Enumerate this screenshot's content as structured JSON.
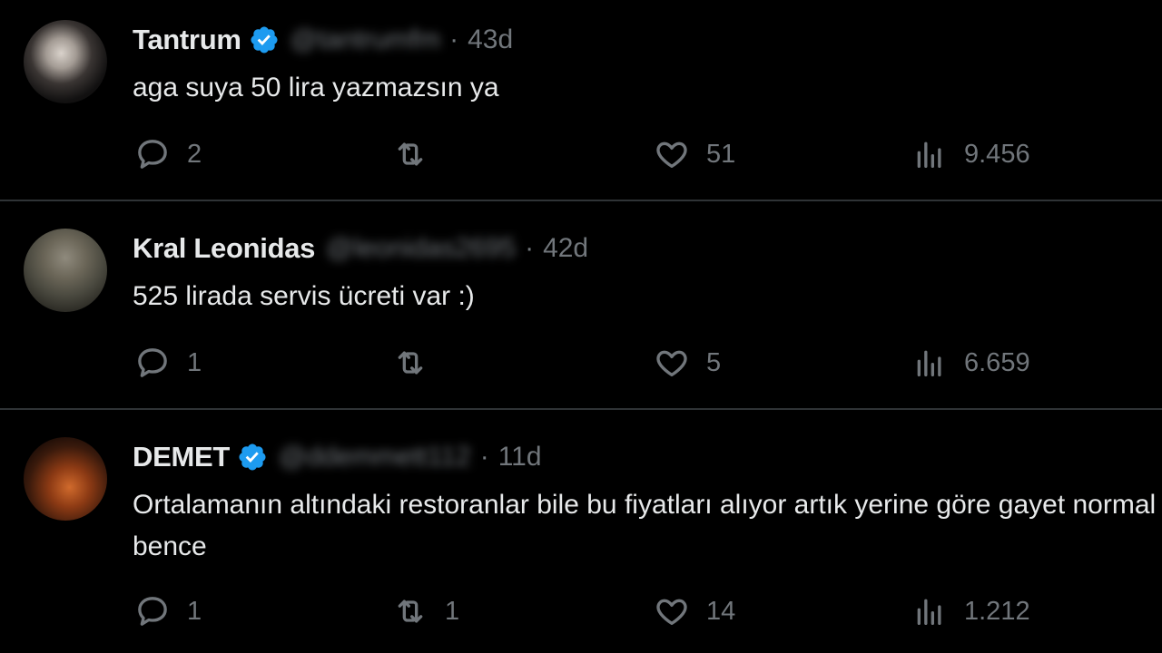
{
  "tweets": [
    {
      "name": "Tantrum",
      "verified": true,
      "handle": "@tantrumfm",
      "separator": "·",
      "time": "43d",
      "text": "aga suya 50 lira yazmazsın ya",
      "replies": "2",
      "retweets": "",
      "likes": "51",
      "views": "9.456"
    },
    {
      "name": "Kral Leonidas",
      "verified": false,
      "handle": "@leonidas2695",
      "separator": "·",
      "time": "42d",
      "text": "525 lirada servis ücreti var :)",
      "replies": "1",
      "retweets": "",
      "likes": "5",
      "views": "6.659"
    },
    {
      "name": "DEMET",
      "verified": true,
      "handle": "@ddemmett112",
      "separator": "·",
      "time": "11d",
      "text": "Ortalamanın altındaki restoranlar bile bu fiyatları alıyor artık yerine göre gayet normal bence",
      "replies": "1",
      "retweets": "1",
      "likes": "14",
      "views": "1.212"
    }
  ],
  "colors": {
    "background": "#000000",
    "text": "#e7e9ea",
    "muted": "#71767b",
    "verified": "#1d9bf0",
    "divider": "#2f3336"
  },
  "icons": {
    "reply": "reply-icon",
    "retweet": "retweet-icon",
    "like": "heart-icon",
    "views": "views-icon",
    "verified": "verified-badge-icon"
  }
}
